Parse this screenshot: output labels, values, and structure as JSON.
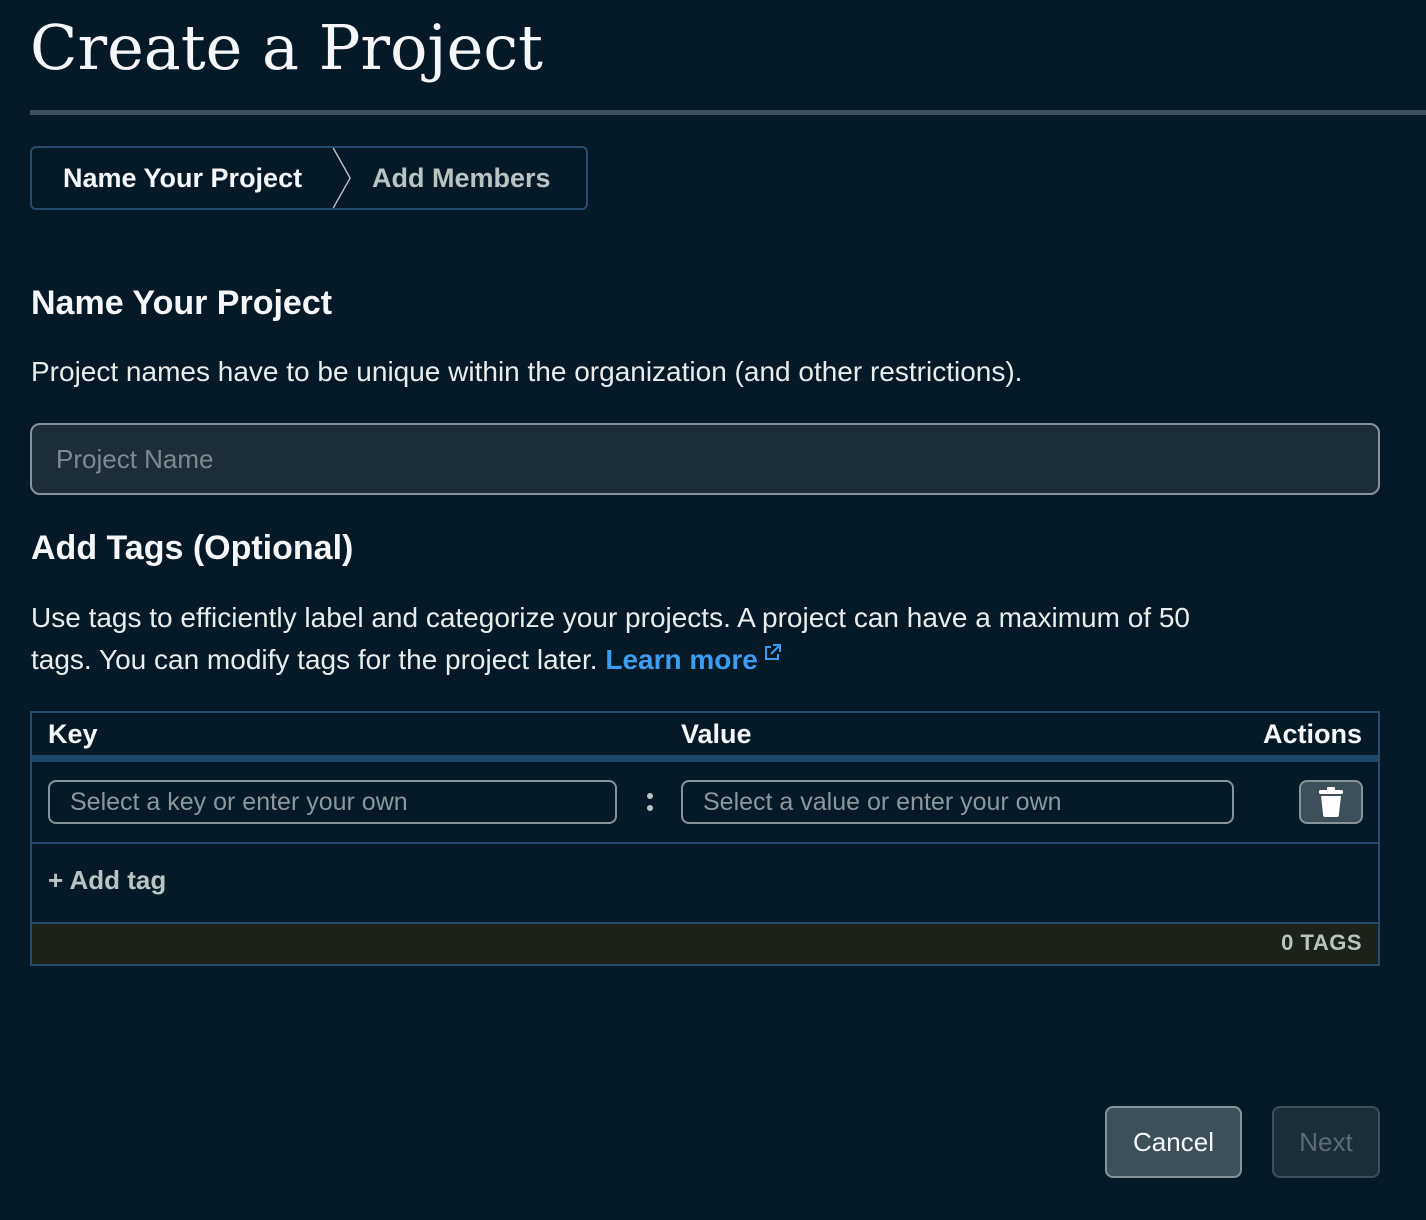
{
  "header": {
    "title": "Create a Project"
  },
  "stepper": {
    "steps": [
      {
        "label": "Name Your Project",
        "active": true
      },
      {
        "label": "Add Members",
        "active": false
      }
    ]
  },
  "name_section": {
    "heading": "Name Your Project",
    "description": "Project names have to be unique within the organization (and other restrictions).",
    "input": {
      "placeholder": "Project Name",
      "value": ""
    }
  },
  "tags_section": {
    "heading": "Add Tags (Optional)",
    "description_line1": "Use tags to efficiently label and categorize your projects. A project can have a maximum of 50",
    "description_line2": "tags. You can modify tags for the project later.",
    "learn_more": "Learn more",
    "table": {
      "columns": {
        "key": "Key",
        "value": "Value",
        "actions": "Actions"
      },
      "rows": [
        {
          "key_placeholder": "Select a key or enter your own",
          "value_placeholder": "Select a value or enter your own",
          "delete_icon": "trash-icon"
        }
      ],
      "add_tag": "+ Add tag",
      "count_label": "0 TAGS"
    }
  },
  "footer": {
    "cancel_label": "Cancel",
    "next_label": "Next"
  },
  "colors": {
    "background": "#061927",
    "border_blue": "#274c6b",
    "link": "#3d9cf0",
    "muted": "#b8c4c2"
  }
}
